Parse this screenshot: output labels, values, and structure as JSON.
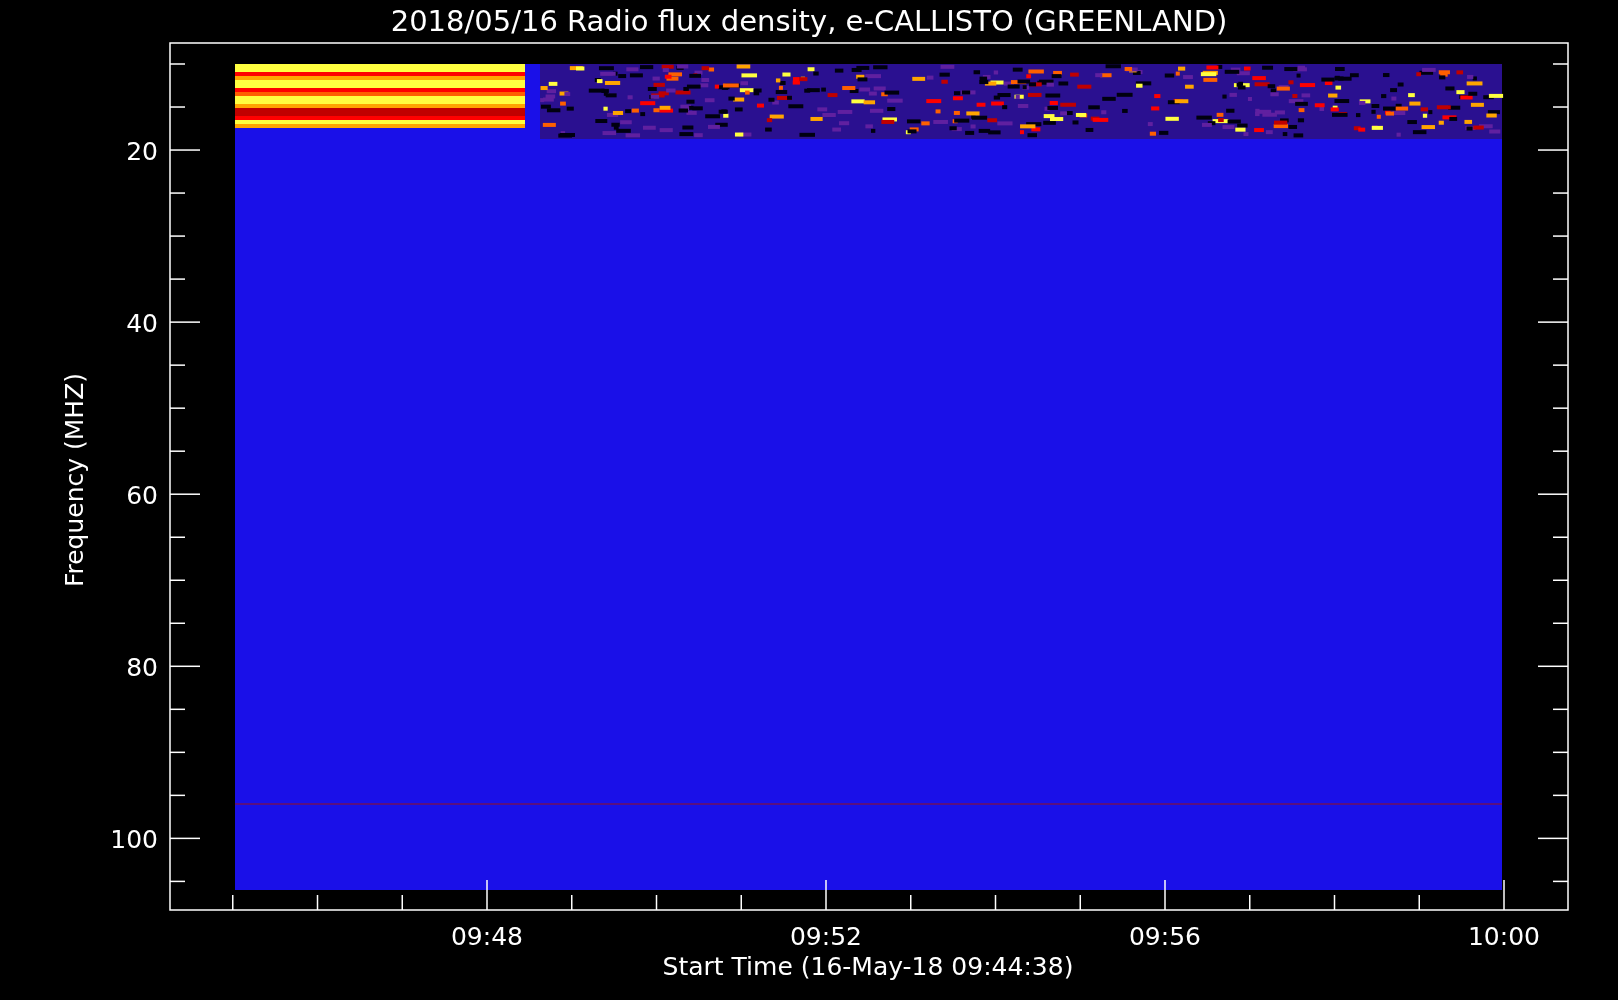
{
  "title": "2018/05/16  Radio flux density, e-CALLISTO (GREENLAND)",
  "y_axis": {
    "label": "Frequency (MHZ)",
    "ticks": [
      "20",
      "40",
      "60",
      "80",
      "100"
    ]
  },
  "x_axis": {
    "label": "Start Time (16-May-18 09:44:38)",
    "ticks": [
      "09:48",
      "09:52",
      "09:56",
      "10:00"
    ]
  }
}
